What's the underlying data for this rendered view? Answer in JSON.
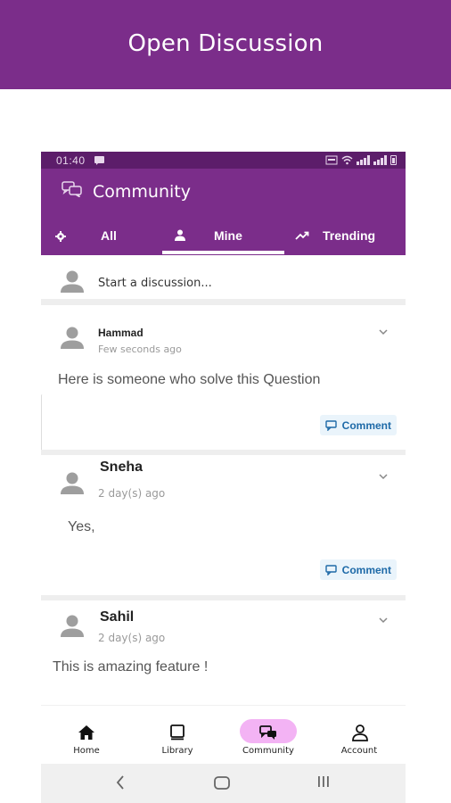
{
  "banner": {
    "title": "Open Discussion"
  },
  "status_bar": {
    "time": "01:40"
  },
  "app_bar": {
    "title": "Community"
  },
  "tabs": [
    {
      "label": "All",
      "icon": "gear-icon"
    },
    {
      "label": "Mine",
      "icon": "person-icon"
    },
    {
      "label": "Trending",
      "icon": "trending-icon"
    }
  ],
  "selected_tab": "Mine",
  "composer": {
    "placeholder": "Start a discussion..."
  },
  "posts": [
    {
      "author": "Hammad",
      "time": "Few seconds ago",
      "body": "Here is someone who solve this Question",
      "comment_label": "Comment"
    },
    {
      "author": "Sneha",
      "time": "2 day(s) ago",
      "body": "Yes,",
      "comment_label": "Comment"
    },
    {
      "author": "Sahil",
      "time": "2 day(s) ago",
      "body": "This is amazing feature !"
    }
  ],
  "bottom_nav": [
    {
      "label": "Home",
      "icon": "home-icon"
    },
    {
      "label": "Library",
      "icon": "library-icon"
    },
    {
      "label": "Community",
      "icon": "community-icon"
    },
    {
      "label": "Account",
      "icon": "account-icon"
    }
  ],
  "active_nav": "Community",
  "colors": {
    "primary": "#7b2d8a",
    "status_bar": "#5c1d6a",
    "active_pill": "#f3b3f4",
    "comment_button": "#eaf4fb",
    "comment_text": "#1e6aa8"
  }
}
